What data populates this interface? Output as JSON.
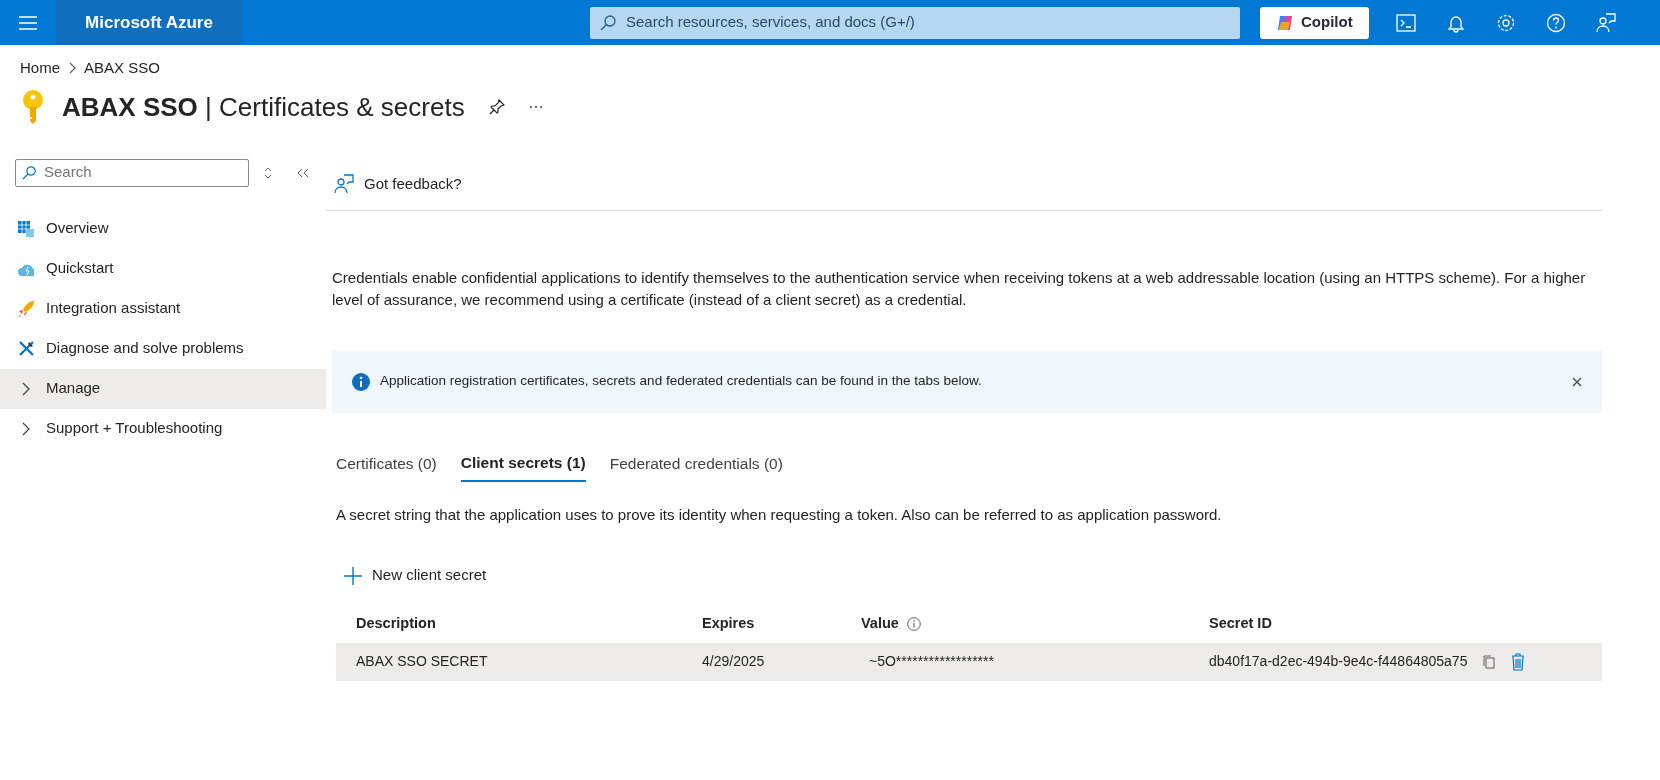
{
  "topbar": {
    "brand": "Microsoft Azure",
    "search": {
      "placeholder": "Search resources, services, and docs (G+/)"
    },
    "copilot": "Copilot"
  },
  "breadcrumb": [
    "Home",
    "ABAX SSO"
  ],
  "page_title": {
    "resource": "ABAX SSO",
    "separator": "|",
    "section": "Certificates & secrets"
  },
  "sidebar": {
    "search": {
      "placeholder": "Search"
    },
    "items": [
      {
        "label": "Overview",
        "kind": "icon",
        "selected": false
      },
      {
        "label": "Quickstart",
        "kind": "icon",
        "selected": false
      },
      {
        "label": "Integration assistant",
        "kind": "icon",
        "selected": false
      },
      {
        "label": "Diagnose and solve problems",
        "kind": "icon",
        "selected": false
      },
      {
        "label": "Manage",
        "kind": "group",
        "selected": true
      },
      {
        "label": "Support + Troubleshooting",
        "kind": "group",
        "selected": false
      }
    ]
  },
  "toolbar": {
    "feedback": "Got feedback?"
  },
  "intro": "Credentials enable confidential applications to identify themselves to the authentication service when receiving tokens at a web addressable location (using an HTTPS scheme). For a higher level of assurance, we recommend using a certificate (instead of a client secret) as a credential.",
  "info_bar": "Application registration certificates, secrets and federated credentials can be found in the tabs below.",
  "tabs": [
    {
      "label": "Certificates (0)",
      "selected": false
    },
    {
      "label": "Client secrets (1)",
      "selected": true
    },
    {
      "label": "Federated credentials (0)",
      "selected": false
    }
  ],
  "tab_description": "A secret string that the application uses to prove its identity when requesting a token. Also can be referred to as application password.",
  "new_button": "New client secret",
  "table": {
    "columns": [
      "Description",
      "Expires",
      "Value",
      "Secret ID"
    ],
    "rows": [
      {
        "description": "ABAX SSO SECRET",
        "expires": "4/29/2025",
        "value": "~5O******************",
        "secret_id": "db40f17a-d2ec-494b-9e4c-f44864805a75"
      }
    ]
  }
}
